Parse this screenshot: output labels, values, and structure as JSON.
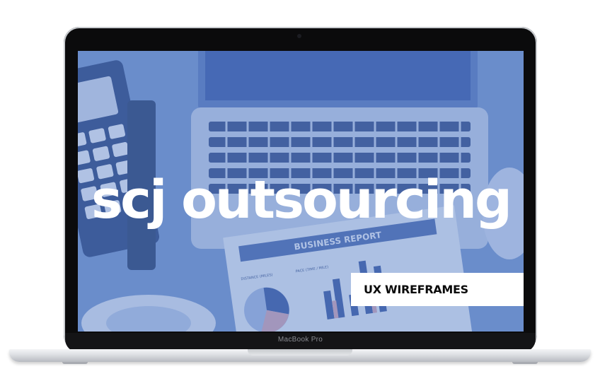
{
  "screen": {
    "headline": "scj outsourcing",
    "tag_label": "UX WIREFRAMES"
  },
  "background_photo": {
    "report_title": "BUSINESS REPORT",
    "label_distance": "DISTANCE (MILES)",
    "label_pace": "PACE (TIME / MILE)"
  },
  "device": {
    "model_label": "MacBook Pro"
  },
  "colors": {
    "overlay_tint": "#5a7fc4",
    "text": "#ffffff",
    "tag_bg": "#ffffff",
    "tag_text": "#0a0a0a"
  }
}
